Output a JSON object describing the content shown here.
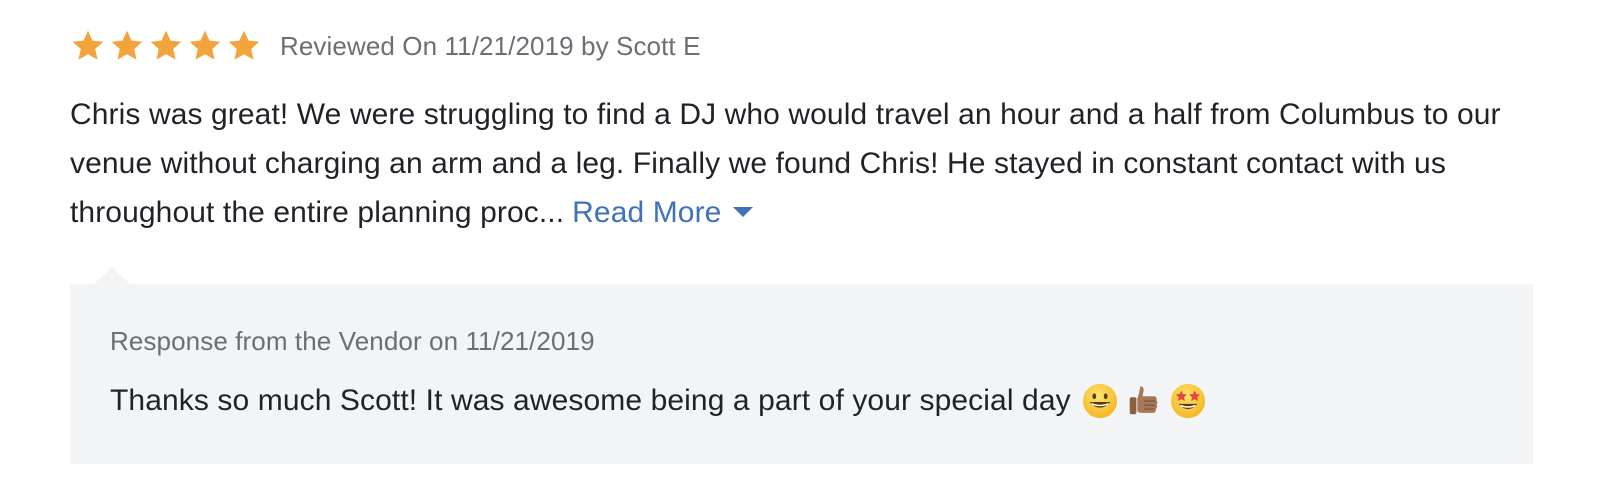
{
  "review": {
    "rating": 5,
    "rating_max": 5,
    "meta": "Reviewed On 11/21/2019 by Scott E",
    "body_text": "Chris was great! We were struggling to find a DJ who would travel an hour and a half from Columbus to our venue without charging an arm and a leg. Finally we found Chris! He stayed in constant contact with us throughout the entire planning proc...",
    "read_more_label": "Read More",
    "star_color": "#f3a33b",
    "link_color": "#3f72b8"
  },
  "response": {
    "header": "Response from the Vendor on 11/21/2019",
    "text": "Thanks so much Scott! It was awesome being a part of your special day",
    "emojis": [
      "grinning-face-emoji",
      "thumbs-up-emoji",
      "star-struck-emoji"
    ],
    "background": "#f3f4f6"
  }
}
